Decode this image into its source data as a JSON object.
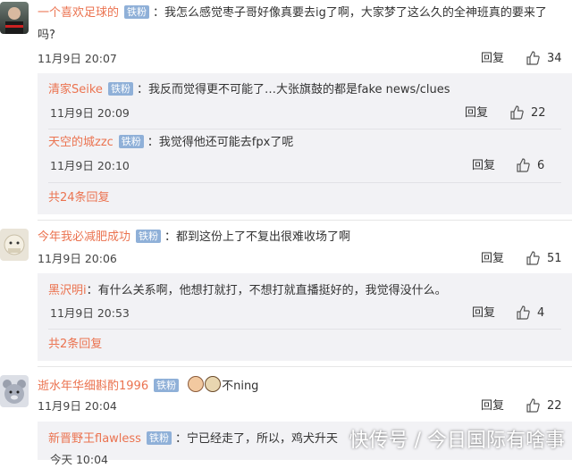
{
  "comments": [
    {
      "user": "一个喜欢足球的",
      "badge": "铁粉",
      "text": "：我怎么感觉枣子哥好像真要去ig了啊，大家梦了这么久的全神班真的要来了",
      "text_cont": "吗?",
      "time": "11月9日 20:07",
      "reply": "回复",
      "likes": "34",
      "replies": [
        {
          "user": "清家Seike",
          "badge": "铁粉",
          "text": "：我反而觉得更不可能了…大张旗鼓的都是fake news/clues",
          "time": "11月9日 20:09",
          "reply": "回复",
          "likes": "22"
        },
        {
          "user": "天空的城zzc",
          "badge": "铁粉",
          "text": "：我觉得他还可能去fpx了呢",
          "time": "11月9日 20:10",
          "reply": "回复",
          "likes": "6"
        }
      ],
      "more": "共24条回复"
    },
    {
      "user": "今年我必减肥成功",
      "badge": "铁粉",
      "text": "：都到这份上了不复出很难收场了啊",
      "time": "11月9日 20:06",
      "reply": "回复",
      "likes": "51",
      "replies": [
        {
          "user": "黑沢明i",
          "text": "：有什么关系啊，他想打就打，不想打就直播挺好的，我觉得没什么。",
          "time": "11月9日 20:53",
          "reply": "回复",
          "likes": "4"
        }
      ],
      "more": "共2条回复"
    },
    {
      "user": "逝水年华细斟酌1996",
      "badge": "铁粉",
      "text": "不ning",
      "time": "11月9日 20:04",
      "reply": "回复",
      "likes": "22",
      "replies": [
        {
          "user": "新晋野王flawless",
          "badge": "铁粉",
          "text": "：宁已经走了，所以，鸡犬升天",
          "time": "今天 10:04"
        }
      ]
    }
  ],
  "watermark": "快传号 / 今日国际有啥事",
  "colors": {
    "username": "#eb7350",
    "badge": "#8fb0d8",
    "subbox": "#f2f2f5"
  }
}
